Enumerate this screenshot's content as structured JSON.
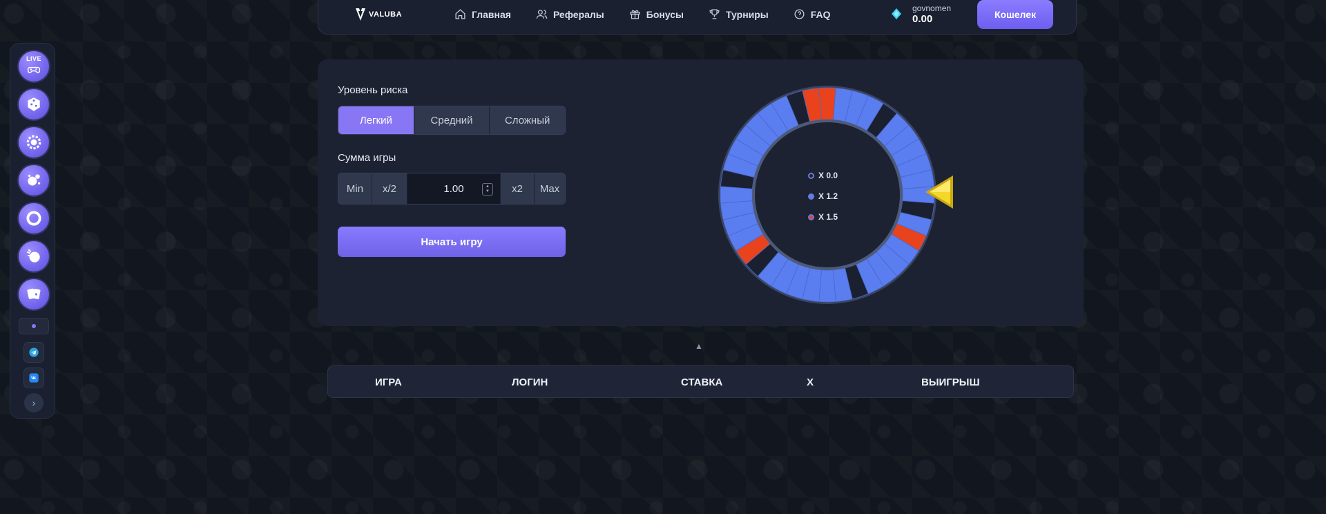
{
  "sidebar": {
    "live_label": "LIVE",
    "games": [
      "live-games-icon",
      "dice-icon",
      "wheel-gear-icon",
      "bubbles-icon",
      "ring-icon",
      "ball-icon",
      "cards-icon"
    ]
  },
  "header": {
    "logo_text": "VALUBA",
    "nav": [
      {
        "label": "Главная",
        "icon": "home-icon"
      },
      {
        "label": "Рефералы",
        "icon": "users-icon"
      },
      {
        "label": "Бонусы",
        "icon": "gift-icon"
      },
      {
        "label": "Турниры",
        "icon": "trophy-icon"
      },
      {
        "label": "FAQ",
        "icon": "question-icon"
      }
    ],
    "username": "govnomen",
    "balance": "0.00",
    "wallet_label": "Кошелек"
  },
  "game": {
    "risk_label": "Уровень риска",
    "risk_options": [
      "Легкий",
      "Средний",
      "Сложный"
    ],
    "risk_selected": "Легкий",
    "bet_label": "Сумма игры",
    "bet_min": "Min",
    "bet_half": "x/2",
    "bet_value": "1.00",
    "bet_double": "x2",
    "bet_max": "Max",
    "start_label": "Начать игру",
    "legend": [
      {
        "label": "X 0.0",
        "color": "#1b2030"
      },
      {
        "label": "X 1.2",
        "color": "#5a7df0"
      },
      {
        "label": "X 1.5",
        "color": "#e8431c"
      }
    ],
    "colors": {
      "dark": "#1b2030",
      "blue": "#5a7df0",
      "red": "#e8431c",
      "accent": "#8877f4"
    }
  },
  "history_table": {
    "columns": [
      "ИГРА",
      "ЛОГИН",
      "СТАВКА",
      "X",
      "ВЫИГРЫШ"
    ]
  }
}
